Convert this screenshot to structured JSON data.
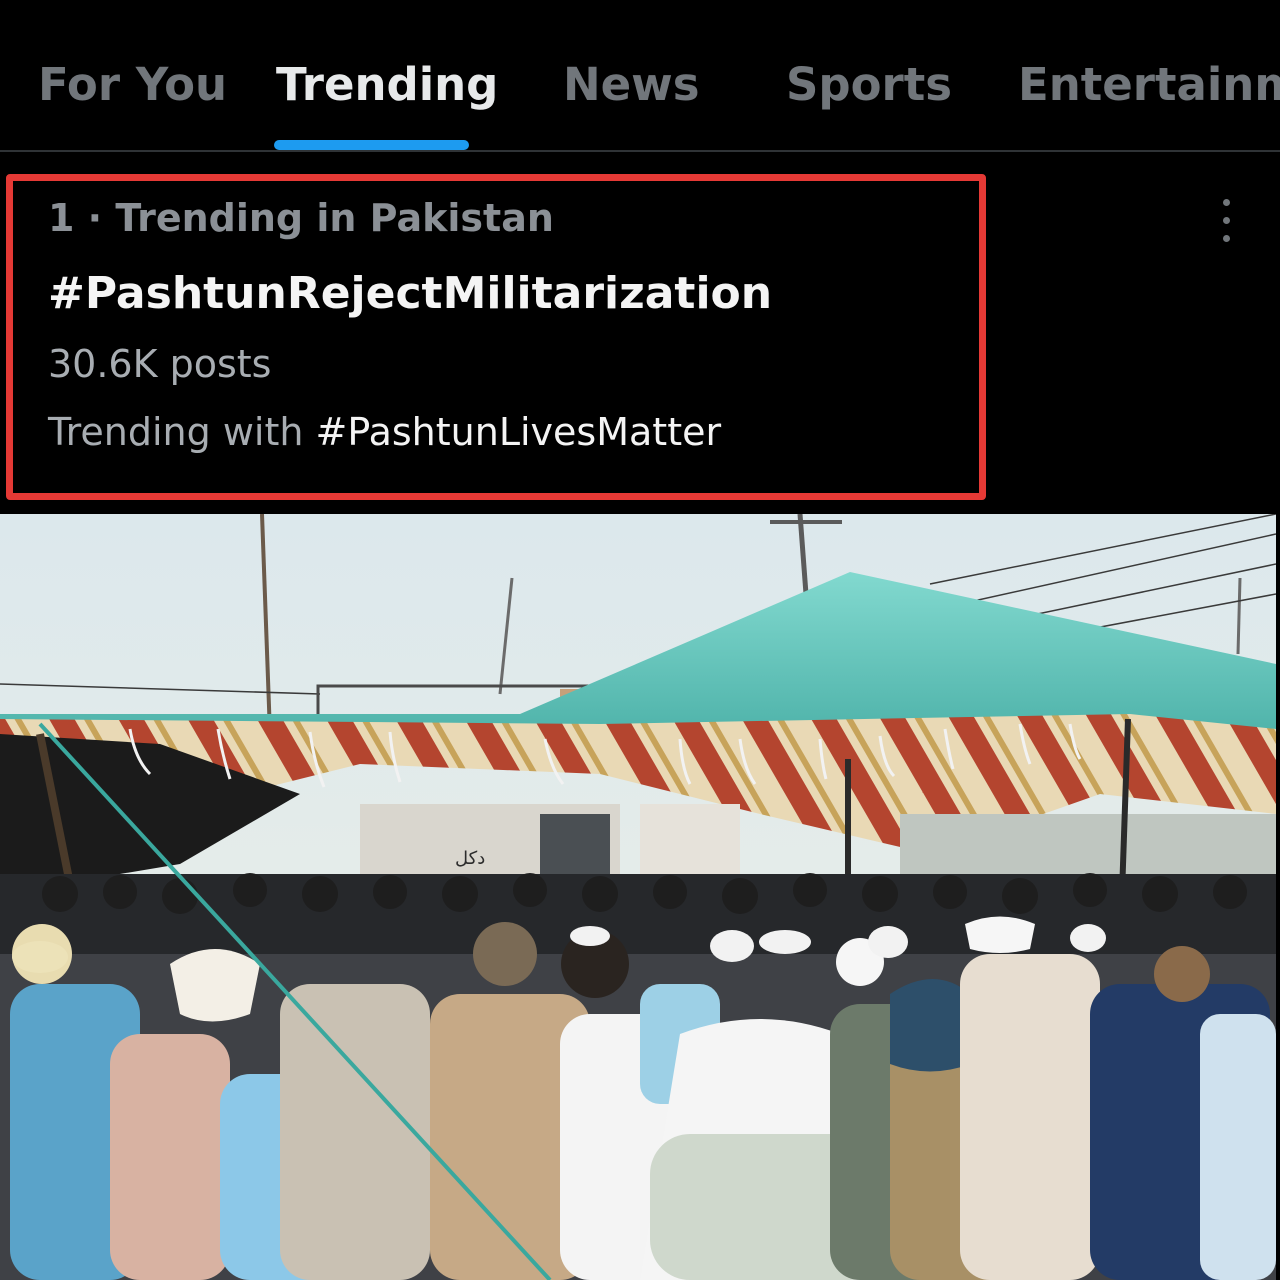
{
  "tabs": [
    {
      "label": "For You",
      "active": false
    },
    {
      "label": "Trending",
      "active": true
    },
    {
      "label": "News",
      "active": false
    },
    {
      "label": "Sports",
      "active": false
    },
    {
      "label": "Entertainme",
      "active": false
    }
  ],
  "trend": {
    "meta": "1 · Trending in Pakistan",
    "hashtag": "#PashtunRejectMilitarization",
    "posts": "30.6K posts",
    "trending_with_prefix": "Trending with ",
    "trending_with_tag": "#PashtunLivesMatter",
    "more_icon": "more-vertical-icon"
  },
  "photo": {
    "sign_text": "دکل"
  },
  "colors": {
    "background": "#000000",
    "accent": "#1d9bf0",
    "highlight_border": "#e53935",
    "tent_top": "#6fcfc4",
    "sky": "#e2ecef"
  }
}
